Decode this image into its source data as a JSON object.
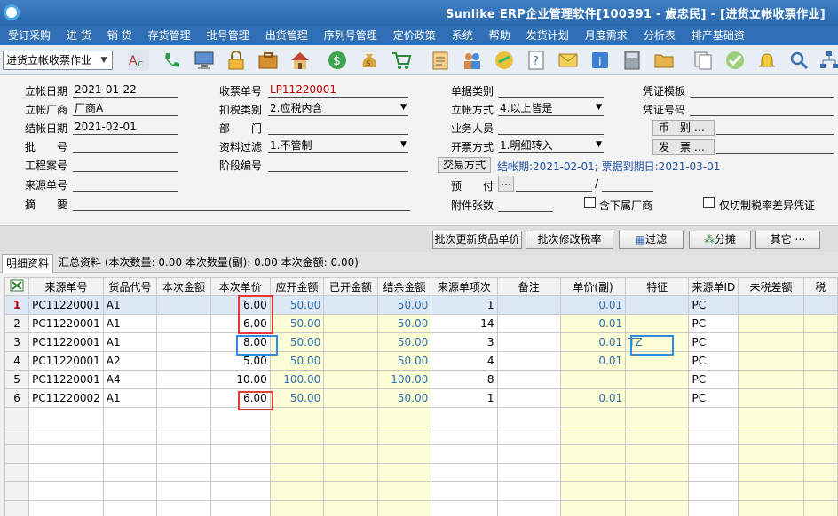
{
  "window": {
    "title": "Sunlike ERP企业管理软件[100391 - 歲忠民] - [进货立帐收票作业]"
  },
  "menu": [
    "受订采购",
    "进 货",
    "销 货",
    "存货管理",
    "批号管理",
    "出货管理",
    "序列号管理",
    "定价政策",
    "系统",
    "帮助",
    "发货计划",
    "月度需求",
    "分析表",
    "排产基础资"
  ],
  "toolbar": {
    "form_select": "进货立帐收票作业"
  },
  "form": {
    "lizhang_date_label": "立帐日期",
    "lizhang_date": "2021-01-22",
    "lizhang_vendor_label": "立帐厂商",
    "lizhang_vendor": "厂商A",
    "jiezhang_date_label": "结帐日期",
    "jiezhang_date": "2021-02-01",
    "pihao_label": "批　　号",
    "project_label": "工程案号",
    "source_no_label": "来源单号",
    "summary_label": "摘　　要",
    "receipt_no_label": "收票单号",
    "receipt_no": "LP11220001",
    "tax_type_label": "扣税类别",
    "tax_type": "2.应税内含",
    "dept_label": "部　　门",
    "filter_label": "资料过滤",
    "filter": "1.不管制",
    "stage_label": "阶段编号",
    "doc_type_label": "单据类别",
    "lizhang_way_label": "立帐方式",
    "lizhang_way": "4.以上皆是",
    "staff_label": "业务人员",
    "invoice_way_label": "开票方式",
    "invoice_way": "1.明细转入",
    "trade_way_btn": "交易方式",
    "trade_info": "结帐期:2021-02-01; 票据到期日:2021-03-01",
    "prepay_label": "预　　付",
    "attach_label": "附件张数",
    "voucher_tpl_label": "凭证模板",
    "voucher_no_label": "凭证号码",
    "currency_label": "币　别",
    "invoice_label": "发　票",
    "ellipsis": "…",
    "slash": "/",
    "sub_vendor_label": "含下属厂商",
    "tax_diff_label": "仅切制税率差异凭证"
  },
  "actions": {
    "batch_update_price": "批次更新货品单价",
    "batch_modify_tax": "批次修改税率",
    "filter": "过滤",
    "split": "分摊",
    "other": "其它 ⋯"
  },
  "tabs": {
    "detail": "明细资料",
    "summary": "汇总资料 (本次数量: 0.00 本次数量(副): 0.00 本次金额: 0.00)"
  },
  "grid": {
    "columns": [
      "来源单号",
      "货品代号",
      "本次金额",
      "本次单价",
      "应开金额",
      "已开金额",
      "结余金额",
      "来源单项次",
      "备注",
      "单价(副)",
      "特征",
      "来源单ID",
      "未税差额",
      "税"
    ],
    "rows": [
      {
        "idx": "1",
        "src": "PC11220001",
        "item": "A1",
        "amt": "",
        "price": "6.00",
        "due": "50.00",
        "opened": "",
        "balance": "50.00",
        "seq": "1",
        "note": "",
        "sub_price": "0.01",
        "feature": "",
        "src_id": "PC",
        "diff": ""
      },
      {
        "idx": "2",
        "src": "PC11220001",
        "item": "A1",
        "amt": "",
        "price": "6.00",
        "due": "50.00",
        "opened": "",
        "balance": "50.00",
        "seq": "14",
        "note": "",
        "sub_price": "0.01",
        "feature": "",
        "src_id": "PC",
        "diff": ""
      },
      {
        "idx": "3",
        "src": "PC11220001",
        "item": "A1",
        "amt": "",
        "price": "8.00",
        "due": "50.00",
        "opened": "",
        "balance": "50.00",
        "seq": "3",
        "note": "",
        "sub_price": "0.01",
        "feature": "TZ",
        "src_id": "PC",
        "diff": ""
      },
      {
        "idx": "4",
        "src": "PC11220001",
        "item": "A2",
        "amt": "",
        "price": "5.00",
        "due": "50.00",
        "opened": "",
        "balance": "50.00",
        "seq": "4",
        "note": "",
        "sub_price": "0.01",
        "feature": "",
        "src_id": "PC",
        "diff": ""
      },
      {
        "idx": "5",
        "src": "PC11220001",
        "item": "A4",
        "amt": "",
        "price": "10.00",
        "due": "100.00",
        "opened": "",
        "balance": "100.00",
        "seq": "8",
        "note": "",
        "sub_price": "",
        "feature": "",
        "src_id": "PC",
        "diff": ""
      },
      {
        "idx": "6",
        "src": "PC11220002",
        "item": "A1",
        "amt": "",
        "price": "6.00",
        "due": "50.00",
        "opened": "",
        "balance": "50.00",
        "seq": "1",
        "note": "",
        "sub_price": "0.01",
        "feature": "",
        "src_id": "PC",
        "diff": ""
      }
    ],
    "empty_rows": 6
  },
  "colors": {
    "title_bar": "#2a68ae",
    "menu_bar": "#2f6fb5",
    "highlight_red": "#e53935",
    "highlight_blue": "#2f8be0",
    "yellow_col": "#fefed6"
  }
}
